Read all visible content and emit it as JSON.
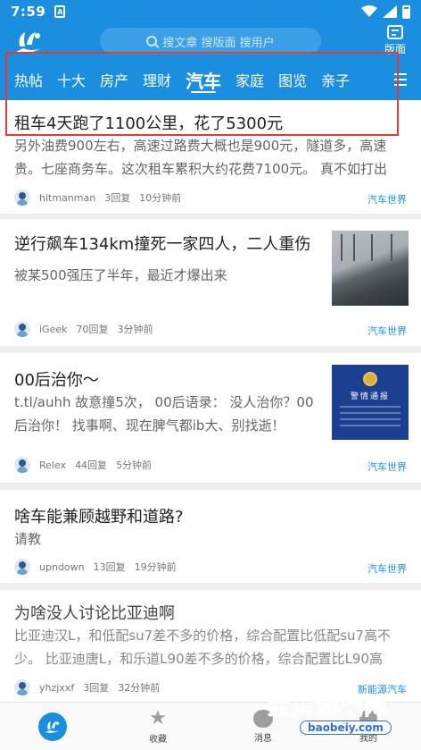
{
  "status_bar": {
    "time": "7:59",
    "sim_label": "A"
  },
  "header": {
    "search_placeholder": "搜文章 搜版面 搜用户",
    "duanmian_label": "版面"
  },
  "tabs": [
    {
      "label": "热帖",
      "active": false
    },
    {
      "label": "十大",
      "active": false
    },
    {
      "label": "房产",
      "active": false
    },
    {
      "label": "理财",
      "active": false
    },
    {
      "label": "汽车",
      "active": true
    },
    {
      "label": "家庭",
      "active": false
    },
    {
      "label": "图览",
      "active": false
    },
    {
      "label": "亲子",
      "active": false
    }
  ],
  "posts": [
    {
      "title": "租车4天跑了1100公里，花了5300元",
      "summary_lines": [
        "另外油费900左右，高速过路费大概也是900元，隧道多，高速",
        "贵。七座商务车。这次租车累积大约花费7100元。 真不如打出"
      ],
      "author": "hitmanman",
      "replies": "3回复",
      "time": "10分钟前",
      "forum": "汽车世界"
    },
    {
      "title": "逆行飙车134km撞死一家四人，二人重伤",
      "summary_lines": [
        "被某500强压了半年，最近才爆出来"
      ],
      "author": "iGeek",
      "replies": "70回复",
      "time": "3分钟前",
      "forum": "汽车世界"
    },
    {
      "title": "00后治你～",
      "summary_lines": [
        "t.tl/auhh 故意撞5次， 00后语录： 没人治你？00",
        "后治你！ 找事啊、现在脾气都ib大、别找逝！"
      ],
      "author": "Relex",
      "replies": "44回复",
      "time": "5分钟前",
      "forum": "汽车世界",
      "thumb_text": "警情通报"
    },
    {
      "title": "啥车能兼顾越野和道路?",
      "summary_lines": [
        "请教"
      ],
      "author": "upndown",
      "replies": "13回复",
      "time": "19分钟前",
      "forum": "汽车世界"
    },
    {
      "title": "为啥没人讨论比亚迪啊",
      "summary_lines": [
        "比亚迪汉L，和低配su7差不多的价格，综合配置比低配su7高不",
        "少。 比亚迪唐L，和乐道L90差不多的价格，综合配置比L90高"
      ],
      "author": "yhzjxxf",
      "replies": "3回复",
      "time": "32分钟前",
      "forum": "新能源汽车"
    }
  ],
  "bottom_nav": [
    {
      "label": "",
      "icon": "home-icon"
    },
    {
      "label": "收藏",
      "icon": "star-icon"
    },
    {
      "label": "消息",
      "icon": "message-icon"
    },
    {
      "label": "我的",
      "icon": "profile-icon"
    }
  ],
  "watermark": {
    "title": "宝贝游戏网",
    "url": "baobeiy.com"
  },
  "colors": {
    "brand": "#1b8ee0",
    "highlight": "#e53935",
    "forum_link": "#1b8ee0"
  }
}
